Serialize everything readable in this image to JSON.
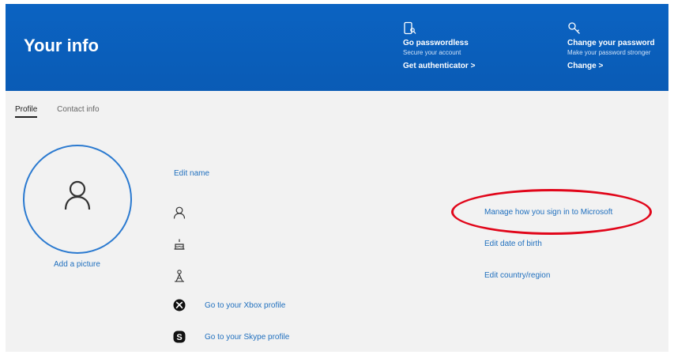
{
  "header": {
    "title": "Your info",
    "promos": [
      {
        "icon": "phone-key-icon",
        "heading": "Go passwordless",
        "sub": "Secure your account",
        "link": "Get authenticator >"
      },
      {
        "icon": "key-icon",
        "heading": "Change your password",
        "sub": "Make your password stronger",
        "link": "Change >"
      }
    ]
  },
  "tabs": [
    {
      "label": "Profile",
      "active": true
    },
    {
      "label": "Contact info",
      "active": false
    }
  ],
  "avatar": {
    "icon": "person-icon",
    "add_picture": "Add a picture"
  },
  "profile": {
    "edit_name": "Edit name",
    "rows": [
      {
        "icon": "person-icon",
        "action": "Manage how you sign in to Microsoft"
      },
      {
        "icon": "cake-icon",
        "action": "Edit date of birth"
      },
      {
        "icon": "globe-person-icon",
        "action": "Edit country/region"
      },
      {
        "icon": "xbox-icon",
        "action": "Go to your Xbox profile"
      },
      {
        "icon": "skype-icon",
        "action": "Go to your Skype profile"
      }
    ]
  },
  "colors": {
    "header_bg": "#0a5bb5",
    "link": "#1f6fbe",
    "highlight": "#e1061a"
  }
}
